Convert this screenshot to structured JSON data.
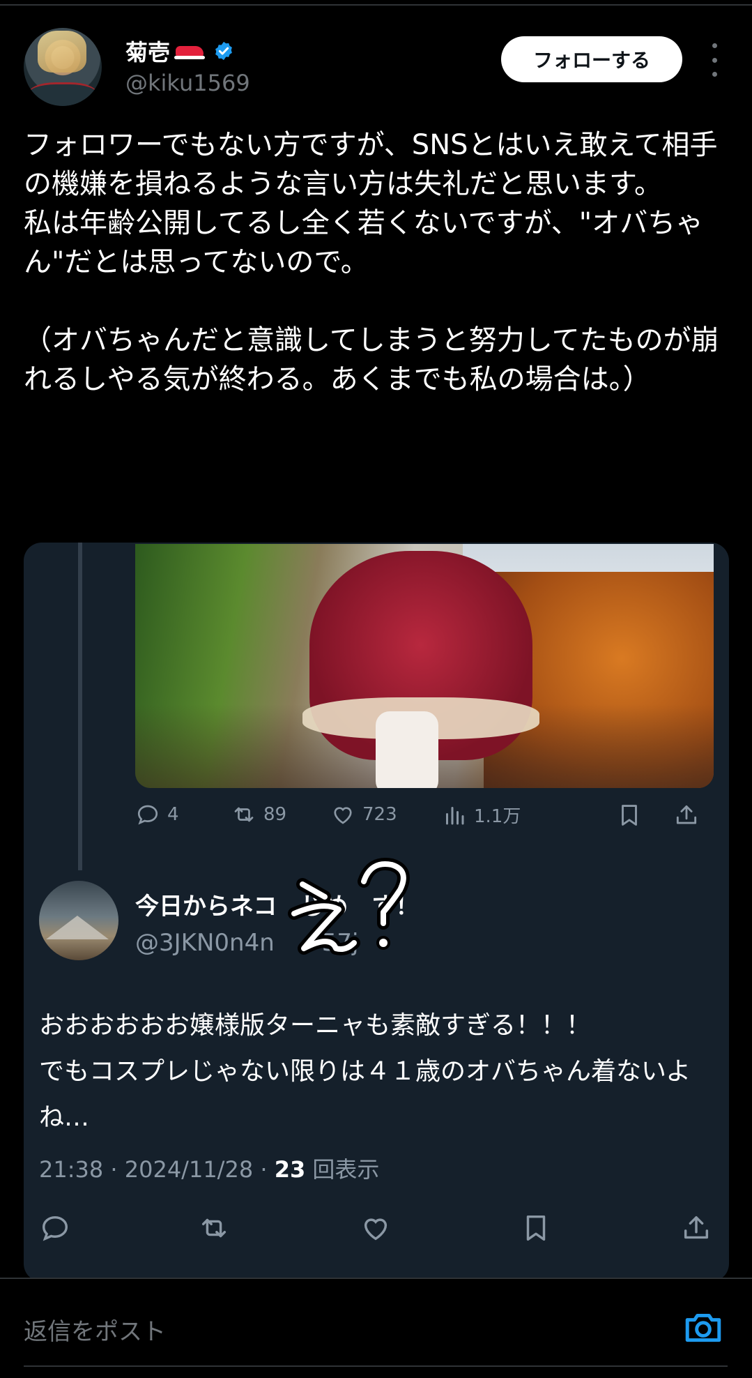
{
  "author": {
    "display_name": "菊壱",
    "handle": "@kiku1569",
    "badge_icon": "shoe-icon",
    "verified": true
  },
  "follow_button_label": "フォローする",
  "tweet_text": "フォロワーでもない方ですが、SNSとはいえ敢えて相手の機嫌を損ねるような言い方は失礼だと思います。\n私は年齢公開してるし全く若くないですが、\"オバちゃん\"だとは思ってないので。\n\n（オバちゃんだと意識してしまうと努力してたものが崩れるしやる気が終わる。あくまでも私の場合は。）",
  "parent_stats": {
    "replies": "4",
    "reposts": "89",
    "likes": "723",
    "views": "1.1万"
  },
  "quoted": {
    "display_name": "今日からネコ　じめ　す！",
    "handle": "@3JKN0n4n　　57j",
    "overlay_scribble": "え？",
    "text": "おおおおおお嬢様版ターニャも素敵すぎる！！！\nでもコスプレじゃない限りは４１歳のオバちゃん着ないよね…",
    "time": "21:38",
    "date": "2024/11/28",
    "views_count": "23",
    "views_label": "回表示"
  },
  "reply_placeholder": "返信をポスト",
  "colors": {
    "background": "#000000",
    "card": "#15202b",
    "secondary_text": "#8b98a5",
    "accent": "#1d9bf0"
  }
}
